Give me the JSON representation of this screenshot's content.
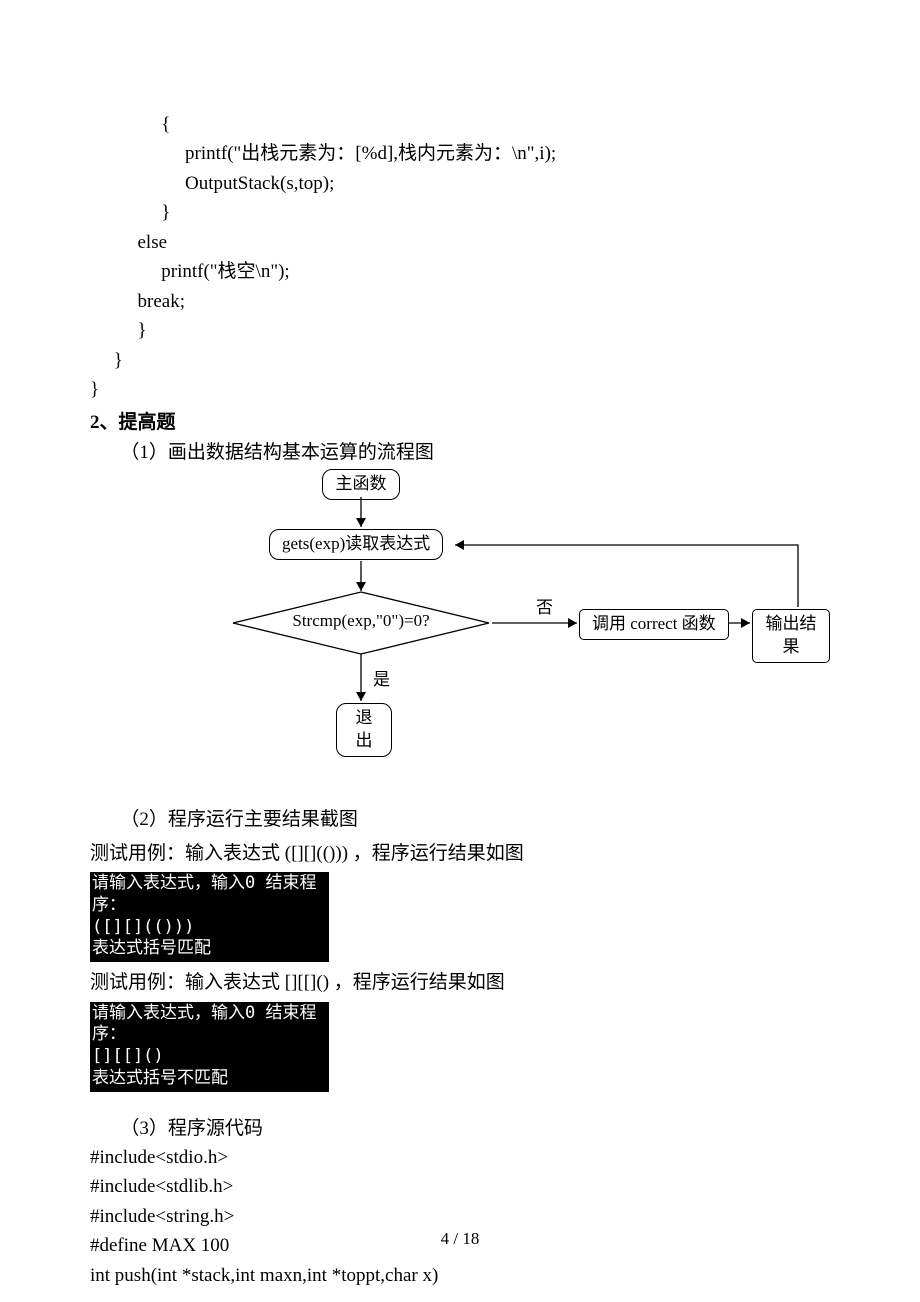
{
  "code_block1": "               {\n                    printf(\"出栈元素为：[%d],栈内元素为：\\n\",i);\n                    OutputStack(s,top);\n               }\n          else\n               printf(\"栈空\\n\");\n          break;\n          }\n     }\n}",
  "heading1": " 2、提高题",
  "sub1": "（1）画出数据结构基本运算的流程图",
  "flow": {
    "main": "主函数",
    "gets": "gets(exp)读取表达式",
    "cond": "Strcmp(exp,\"0\")=0?",
    "no": "否",
    "yes": "是",
    "call": "调用 correct 函数",
    "out": "输出结果",
    "exit": "退出"
  },
  "sub2": "（2）程序运行主要结果截图",
  "case1": "测试用例：输入表达式 ([][](())) ，程序运行结果如图",
  "term1": {
    "l1": "请输入表达式，输入0 结束程序：",
    "l2": "([][](()))",
    "l3": "表达式括号匹配"
  },
  "case2": "测试用例：输入表达式 [][[]() ，程序运行结果如图",
  "term2": {
    "l1": "请输入表达式，输入0 结束程序：",
    "l2": "[][[]()",
    "l3": "表达式括号不匹配"
  },
  "sub3": "（3）程序源代码",
  "src": "#include<stdio.h>\n#include<stdlib.h>\n#include<string.h>\n#define MAX 100\nint push(int *stack,int maxn,int *toppt,char x)",
  "footer": "4  / 18"
}
